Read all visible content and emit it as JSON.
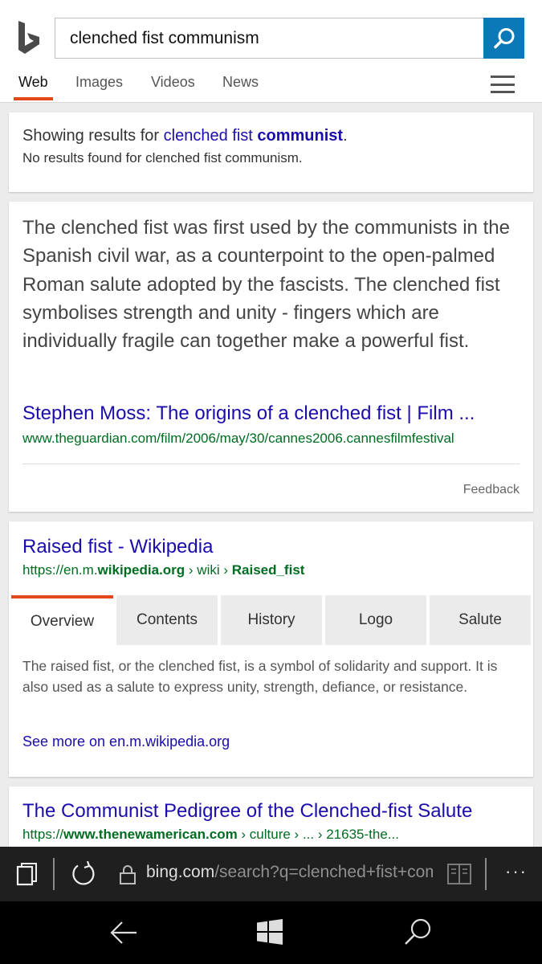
{
  "search": {
    "query": "clenched fist communism"
  },
  "tabs": [
    {
      "label": "Web",
      "active": true
    },
    {
      "label": "Images"
    },
    {
      "label": "Videos"
    },
    {
      "label": "News"
    }
  ],
  "spell": {
    "prefix": "Showing results for ",
    "suggest_normal": "clenched fist ",
    "suggest_bold": "communist",
    "suffix": ".",
    "no_results": "No results found for clenched fist communism."
  },
  "answer": {
    "text": "The clenched fist was first used by the communists in the Spanish civil war, as a counterpoint to the open-palmed Roman salute adopted by the fascists. The clenched fist symbolises strength and unity - fingers which are individually fragile can together make a powerful fist.",
    "title": "Stephen Moss: The origins of a clenched fist | Film ...",
    "url": "www.theguardian.com/film/2006/may/30/cannes2006.cannesfilmfestival",
    "feedback": "Feedback"
  },
  "wiki": {
    "title": "Raised fist - Wikipedia",
    "url_prefix": "https://en.m.",
    "url_domain": "wikipedia.org",
    "url_mid": " › wiki › ",
    "url_page": "Raised_fist",
    "subtabs": [
      "Overview",
      "Contents",
      "History",
      "Logo",
      "Salute"
    ],
    "description": "The raised fist, or the clenched fist, is a symbol of solidarity and support. It is also used as a salute to express unity, strength, defiance, or resistance.",
    "see_more": "See more on en.m.wikipedia.org"
  },
  "result3": {
    "title": "The Communist Pedigree of the Clenched-fist Salute",
    "url_prefix": "https://",
    "url_domain": "www.thenewamerican.com",
    "url_rest": " › culture › ... › 21635-the..."
  },
  "browser": {
    "address_host": "bing.com",
    "address_path": "/search?q=clenched+fist+communism",
    "more": "···"
  },
  "colors": {
    "accent": "#e4481a",
    "link": "#1a0dab",
    "url_green": "#006d21",
    "search_button": "#0b79b8"
  }
}
